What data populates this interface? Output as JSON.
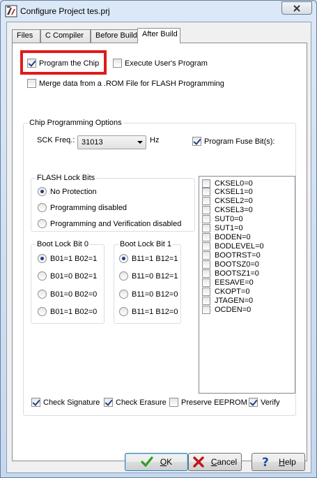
{
  "window": {
    "title": "Configure Project tes.prj",
    "close": "close"
  },
  "tabs": [
    {
      "label": "Files"
    },
    {
      "label": "C Compiler"
    },
    {
      "label": "Before Build"
    },
    {
      "label": "After Build",
      "active": true
    }
  ],
  "options": {
    "program_chip": {
      "label": "Program the Chip",
      "checked": true
    },
    "execute_user": {
      "label": "Execute User's Program",
      "checked": false
    },
    "merge_rom": {
      "label": "Merge data from a .ROM File for FLASH Programming",
      "checked": false
    }
  },
  "chip_prog": {
    "title": "Chip Programming Options",
    "sck_label": "SCK Freq.:",
    "sck_value": "31013",
    "sck_unit": "Hz",
    "program_fuse": {
      "label": "Program Fuse Bit(s):",
      "checked": true
    },
    "flash_lock": {
      "title": "FLASH Lock Bits",
      "options": [
        {
          "label": "No Protection",
          "checked": true
        },
        {
          "label": "Programming disabled",
          "checked": false
        },
        {
          "label": "Programming and Verification disabled",
          "checked": false
        }
      ]
    },
    "boot0": {
      "title": "Boot Lock Bit 0",
      "options": [
        {
          "label": "B01=1 B02=1",
          "checked": true
        },
        {
          "label": "B01=0 B02=1",
          "checked": false
        },
        {
          "label": "B01=0 B02=0",
          "checked": false
        },
        {
          "label": "B01=1 B02=0",
          "checked": false
        }
      ]
    },
    "boot1": {
      "title": "Boot Lock Bit 1",
      "options": [
        {
          "label": "B11=1 B12=1",
          "checked": true
        },
        {
          "label": "B11=0 B12=1",
          "checked": false
        },
        {
          "label": "B11=0 B12=0",
          "checked": false
        },
        {
          "label": "B11=1 B12=0",
          "checked": false
        }
      ]
    },
    "fuses": [
      "CKSEL0=0",
      "CKSEL1=0",
      "CKSEL2=0",
      "CKSEL3=0",
      "SUT0=0",
      "SUT1=0",
      "BODEN=0",
      "BODLEVEL=0",
      "BOOTRST=0",
      "BOOTSZ0=0",
      "BOOTSZ1=0",
      "EESAVE=0",
      "CKOPT=0",
      "JTAGEN=0",
      "OCDEN=0"
    ],
    "bottom": [
      {
        "label": "Check Signature",
        "checked": true
      },
      {
        "label": "Check Erasure",
        "checked": true
      },
      {
        "label": "Preserve EEPROM",
        "checked": false
      },
      {
        "label": "Verify",
        "checked": true
      }
    ]
  },
  "buttons": {
    "ok": {
      "accel": "O",
      "rest": "K"
    },
    "cancel": {
      "accel": "C",
      "rest": "ancel"
    },
    "help": {
      "accel": "H",
      "rest": "elp"
    }
  },
  "colors": {
    "highlight": "#e11a1a",
    "ok_check": "#2f9e1f",
    "cancel_x": "#c0161b",
    "help_q": "#1b4fa0"
  }
}
